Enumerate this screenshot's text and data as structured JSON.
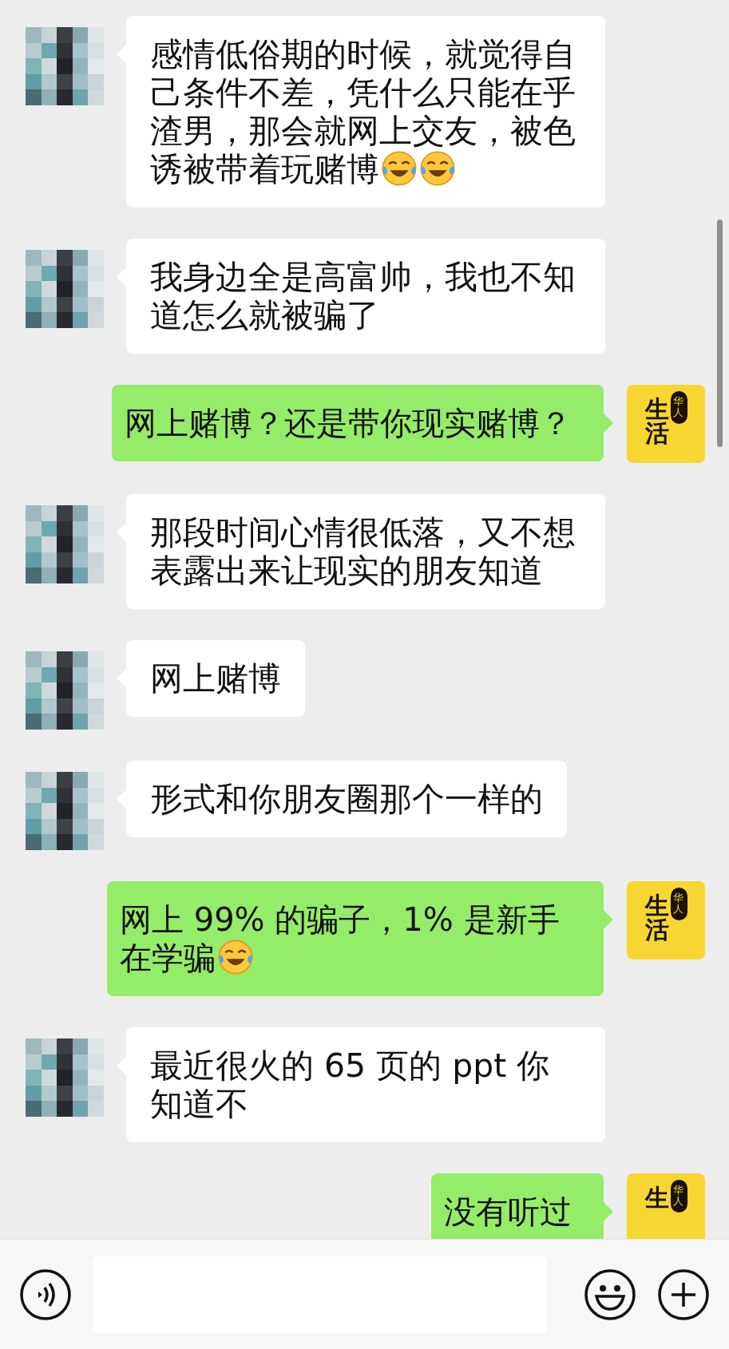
{
  "messages": [
    {
      "kind": "received",
      "text": "感情低俗期的时候，就觉得自己条件不差，凭什么只能在乎渣男，那会就网上交友，被色诱被带着玩赌博",
      "emojis": [
        {
          "kind": "laugh_cry"
        },
        {
          "kind": "laugh_cry"
        }
      ]
    },
    {
      "kind": "received",
      "text": "我身边全是高富帅，我也不知道怎么就被骗了"
    },
    {
      "kind": "sent",
      "text": "网上赌博？还是带你现实赌博？",
      "avatar": {
        "badge": "华人",
        "chars": [
          "生",
          "活"
        ]
      }
    },
    {
      "kind": "received",
      "text": "那段时间心情很低落，又不想表露出来让现实的朋友知道"
    },
    {
      "kind": "received",
      "text": "网上赌博"
    },
    {
      "kind": "received",
      "text": "形式和你朋友圈那个一样的"
    },
    {
      "kind": "sent",
      "text": "网上 99% 的骗子，1% 是新手在学骗",
      "emojis": [
        {
          "kind": "laugh_cry"
        }
      ],
      "avatar": {
        "badge": "华人",
        "chars": [
          "生",
          "活"
        ]
      }
    },
    {
      "kind": "received",
      "text": "最近很火的 65 页的 ppt 你知道不"
    },
    {
      "kind": "sent",
      "text": "没有听过",
      "avatar": {
        "badge": "华人",
        "chars": [
          "生"
        ]
      }
    }
  ]
}
